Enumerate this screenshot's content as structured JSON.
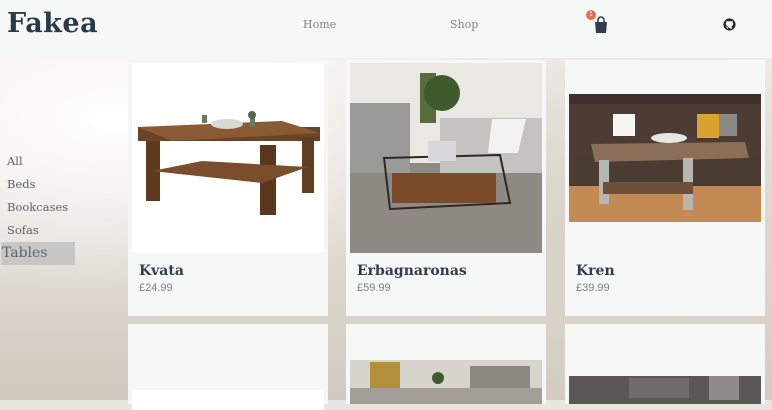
{
  "brand": {
    "logo": "Fakea"
  },
  "nav": {
    "home": "Home",
    "shop": "Shop",
    "cart_count": "1"
  },
  "sidebar": {
    "items": [
      {
        "label": "All"
      },
      {
        "label": "Beds"
      },
      {
        "label": "Bookcases"
      },
      {
        "label": "Sofas"
      },
      {
        "label": "Tables"
      }
    ],
    "active": "Tables"
  },
  "products": [
    {
      "name": "Kvata",
      "price": "£24.99"
    },
    {
      "name": "Erbagnaronas",
      "price": "£59.99"
    },
    {
      "name": "Kren",
      "price": "£39.99"
    }
  ],
  "colors": {
    "accent_badge": "#e86a5a",
    "logo": "#2b3a4a"
  },
  "icons": {
    "cart": "shopping-bag-icon",
    "github": "github-icon"
  }
}
